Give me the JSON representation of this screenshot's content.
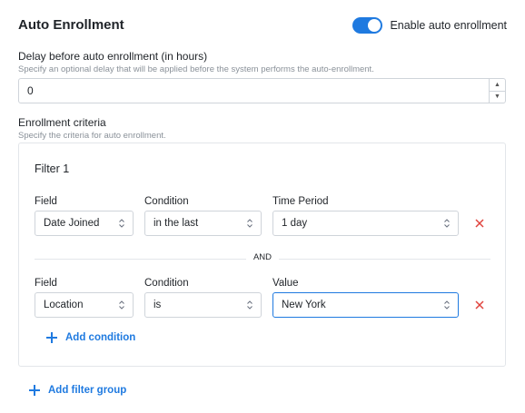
{
  "header": {
    "title": "Auto Enrollment"
  },
  "toggle": {
    "label": "Enable auto enrollment",
    "enabled": true
  },
  "delay": {
    "label": "Delay before auto enrollment (in hours)",
    "help": "Specify an optional delay that will be applied before the system performs the auto-enrollment.",
    "value": "0"
  },
  "criteria": {
    "label": "Enrollment criteria",
    "help": "Specify the criteria for auto enrollment."
  },
  "filter": {
    "title": "Filter 1",
    "joiner": "AND",
    "add_condition_label": "Add condition",
    "rows": [
      {
        "field_label": "Field",
        "field_value": "Date Joined",
        "condition_label": "Condition",
        "condition_value": "in the last",
        "third_label": "Time Period",
        "third_value": "1 day"
      },
      {
        "field_label": "Field",
        "field_value": "Location",
        "condition_label": "Condition",
        "condition_value": "is",
        "third_label": "Value",
        "third_value": "New York"
      }
    ]
  },
  "add_filter_group_label": "Add filter group",
  "colors": {
    "accent": "#1f7ae0",
    "remove": "#e0433d"
  }
}
